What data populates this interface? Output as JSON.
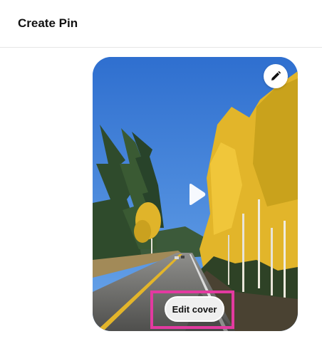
{
  "header": {
    "title": "Create Pin"
  },
  "media": {
    "edit_cover_label": "Edit cover",
    "edit_icon": "pencil-icon",
    "play_icon": "play-icon"
  },
  "colors": {
    "highlight": "#e33aa0",
    "sky": "#3d83dd"
  }
}
